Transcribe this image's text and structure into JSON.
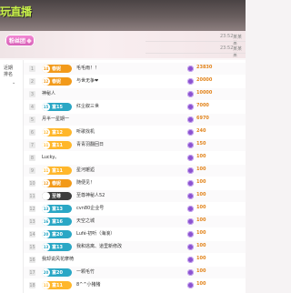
{
  "banner_title": "玩直播",
  "messages": [
    {
      "time": "23:52",
      "name": "某某某"
    },
    {
      "time": "23:52",
      "name": "某某某"
    }
  ],
  "fan_tag": "粉丝团",
  "sidebar": {
    "label": "近期\n排名",
    "expand_arrow": "⌄"
  },
  "colors": {
    "gold": "#f29a1a",
    "blue": "#2aa7c5",
    "orange": "#ffb72b",
    "purple": "#8b53d1",
    "dark": "#3d3d3d"
  },
  "rows": [
    {
      "rank": "1",
      "badge_level": "14",
      "badge_text": "春妮",
      "badge_color": "#f29a1a",
      "name": "毛毛雨！！",
      "score": "23830"
    },
    {
      "rank": "2",
      "badge_level": "12",
      "badge_text": "春妮",
      "badge_color": "#f29a1a",
      "name": "与世无争❤",
      "score": "20000"
    },
    {
      "rank": "3",
      "badge_level": "",
      "badge_text": "",
      "badge_color": "",
      "name": "神秘人",
      "score": "10000"
    },
    {
      "rank": "4",
      "badge_level": "15",
      "badge_text": "富15",
      "badge_color": "#2aa7c5",
      "name": "红尘叙三世",
      "score": "7000"
    },
    {
      "rank": "5",
      "badge_level": "",
      "badge_text": "",
      "badge_color": "",
      "name": "月半一星期一",
      "score": "6970"
    },
    {
      "rank": "6",
      "badge_level": "12",
      "badge_text": "富12",
      "badge_color": "#ffb72b",
      "name": "听歌找机",
      "score": "240"
    },
    {
      "rank": "7",
      "badge_level": "11",
      "badge_text": "富11",
      "badge_color": "#ffb72b",
      "name": "青青羽翻回日",
      "score": "150"
    },
    {
      "rank": "8",
      "badge_level": "",
      "badge_text": "",
      "badge_color": "",
      "name": "Lucky。",
      "score": "100"
    },
    {
      "rank": "9",
      "badge_level": "11",
      "badge_text": "富11",
      "badge_color": "#ffb72b",
      "name": "星河邂逅",
      "score": "100"
    },
    {
      "rank": "10",
      "badge_level": "12",
      "badge_text": "春妮",
      "badge_color": "#f29a1a",
      "name": "随便见！",
      "score": "100"
    },
    {
      "rank": "11",
      "badge_level": "",
      "badge_text": "至尊",
      "badge_color": "#3d3d3d",
      "name": "至尊神秘人52",
      "score": "100"
    },
    {
      "rank": "12",
      "badge_level": "13",
      "badge_text": "富13",
      "badge_color": "#2aa7c5",
      "name": "cvn80企业号",
      "score": "100"
    },
    {
      "rank": "13",
      "badge_level": "16",
      "badge_text": "富16",
      "badge_color": "#2aa7c5",
      "name": "天空之城",
      "score": "100"
    },
    {
      "rank": "14",
      "badge_level": "20",
      "badge_text": "富20",
      "badge_color": "#2aa7c5",
      "name": "Lufé·初听（海浪）",
      "score": "100"
    },
    {
      "rank": "15",
      "badge_level": "13",
      "badge_text": "富13",
      "badge_color": "#2aa7c5",
      "name": "我和逃离、道里新修改",
      "score": "100"
    },
    {
      "rank": "16",
      "badge_level": "",
      "badge_text": "",
      "badge_color": "",
      "name": "我却说风花摩椅",
      "score": "100"
    },
    {
      "rank": "17",
      "badge_level": "20",
      "badge_text": "富20",
      "badge_color": "#2aa7c5",
      "name": "一颗毛竹",
      "score": "100"
    },
    {
      "rank": "18",
      "badge_level": "11",
      "badge_text": "富11",
      "badge_color": "#ffb72b",
      "name": "8^^小猪猪",
      "score": "100"
    }
  ]
}
